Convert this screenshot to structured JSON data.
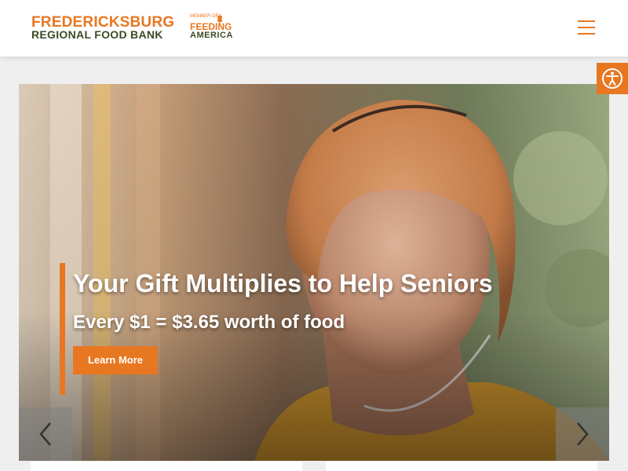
{
  "header": {
    "logo_line1": "FREDERICKSBURG",
    "logo_line2": "REGIONAL FOOD BANK",
    "partner_prefix": "MEMBER OF",
    "partner_line1": "FEEDING",
    "partner_line2": "AMERICA",
    "menu_icon": "hamburger-menu-icon"
  },
  "accessibility": {
    "icon": "accessibility-icon"
  },
  "hero": {
    "title": "Your Gift Multiplies to Help Seniors",
    "subtitle": "Every $1 = $3.65 worth of food",
    "cta_label": "Learn More",
    "prev_icon": "chevron-left-icon",
    "next_icon": "chevron-right-icon"
  },
  "colors": {
    "accent": "#e87722",
    "brand_green": "#3d4a24",
    "page_bg": "#efefef"
  }
}
